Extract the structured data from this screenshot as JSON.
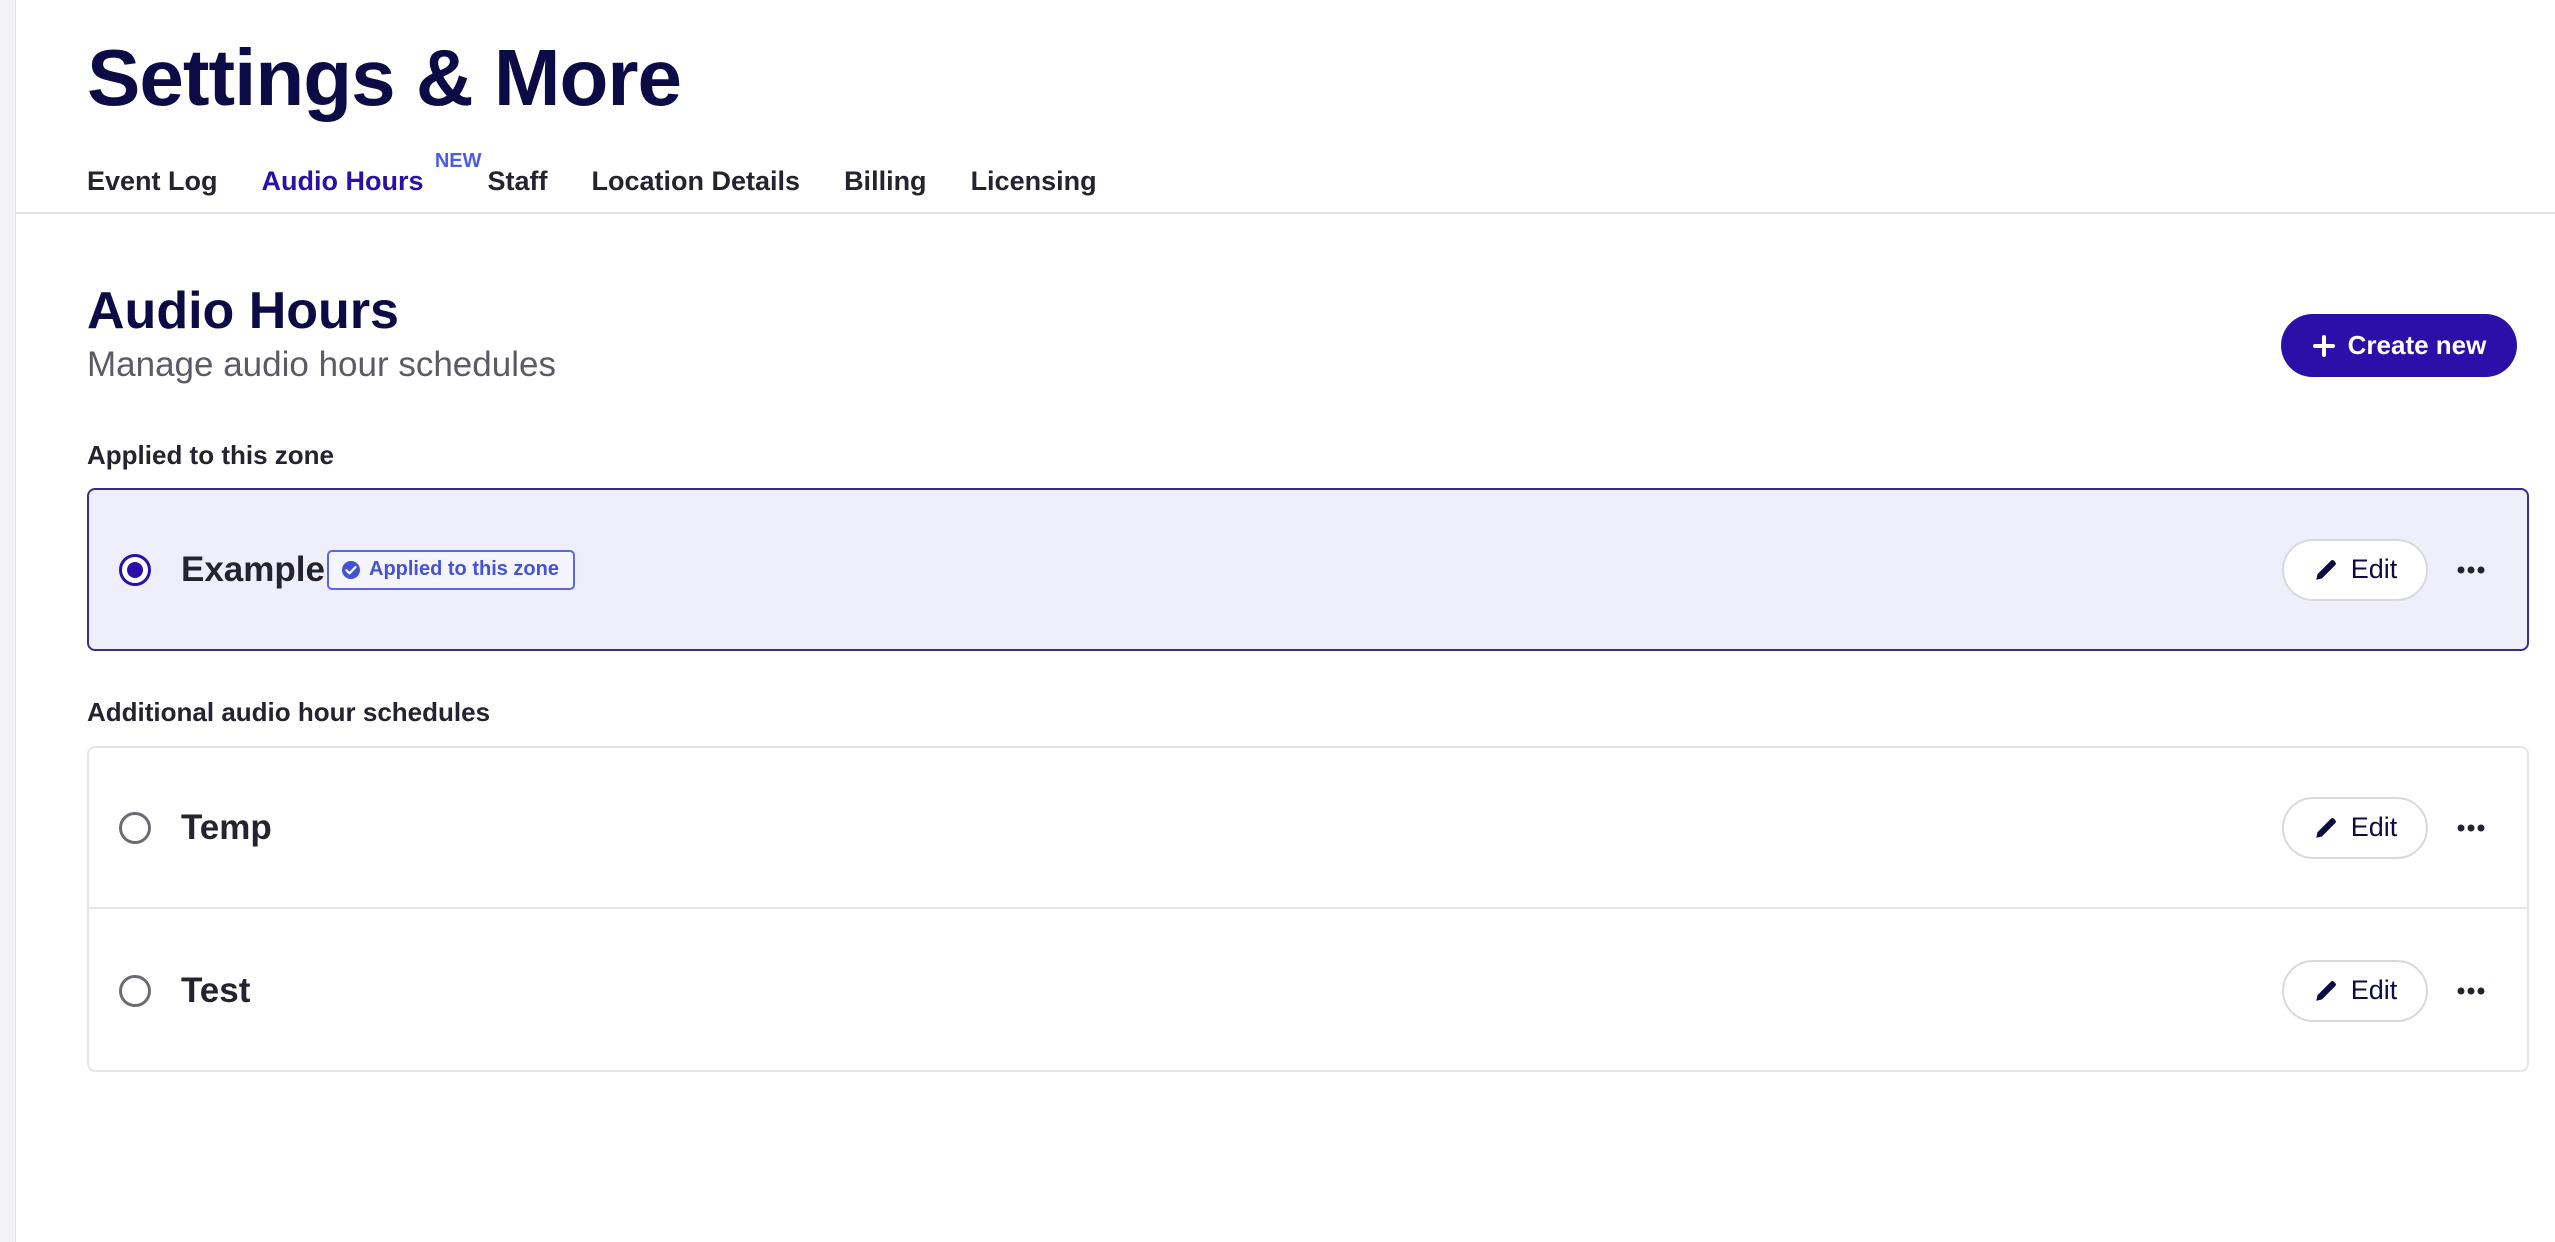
{
  "page": {
    "title": "Settings & More"
  },
  "tabs": [
    {
      "label": "Event Log",
      "active": false
    },
    {
      "label": "Audio Hours",
      "active": true,
      "badge": "NEW"
    },
    {
      "label": "Staff",
      "active": false
    },
    {
      "label": "Location Details",
      "active": false
    },
    {
      "label": "Billing",
      "active": false
    },
    {
      "label": "Licensing",
      "active": false
    }
  ],
  "section": {
    "title": "Audio Hours",
    "subtitle": "Manage audio hour schedules",
    "create_label": "Create new"
  },
  "applied": {
    "group_label": "Applied to this zone",
    "schedule": {
      "name": "Example",
      "selected": true,
      "badge": "Applied to this zone",
      "edit_label": "Edit"
    }
  },
  "additional": {
    "group_label": "Additional audio hour schedules",
    "schedules": [
      {
        "name": "Temp",
        "selected": false,
        "edit_label": "Edit"
      },
      {
        "name": "Test",
        "selected": false,
        "edit_label": "Edit"
      }
    ]
  },
  "colors": {
    "brand": "#2a0fa8",
    "title": "#0c0b45",
    "applied_bg": "#efeffc",
    "badge": "#4452d6"
  },
  "icons": {
    "create": "plus-icon",
    "badge": "check-circle-icon",
    "edit": "pencil-icon",
    "more": "more-horizontal-icon"
  }
}
